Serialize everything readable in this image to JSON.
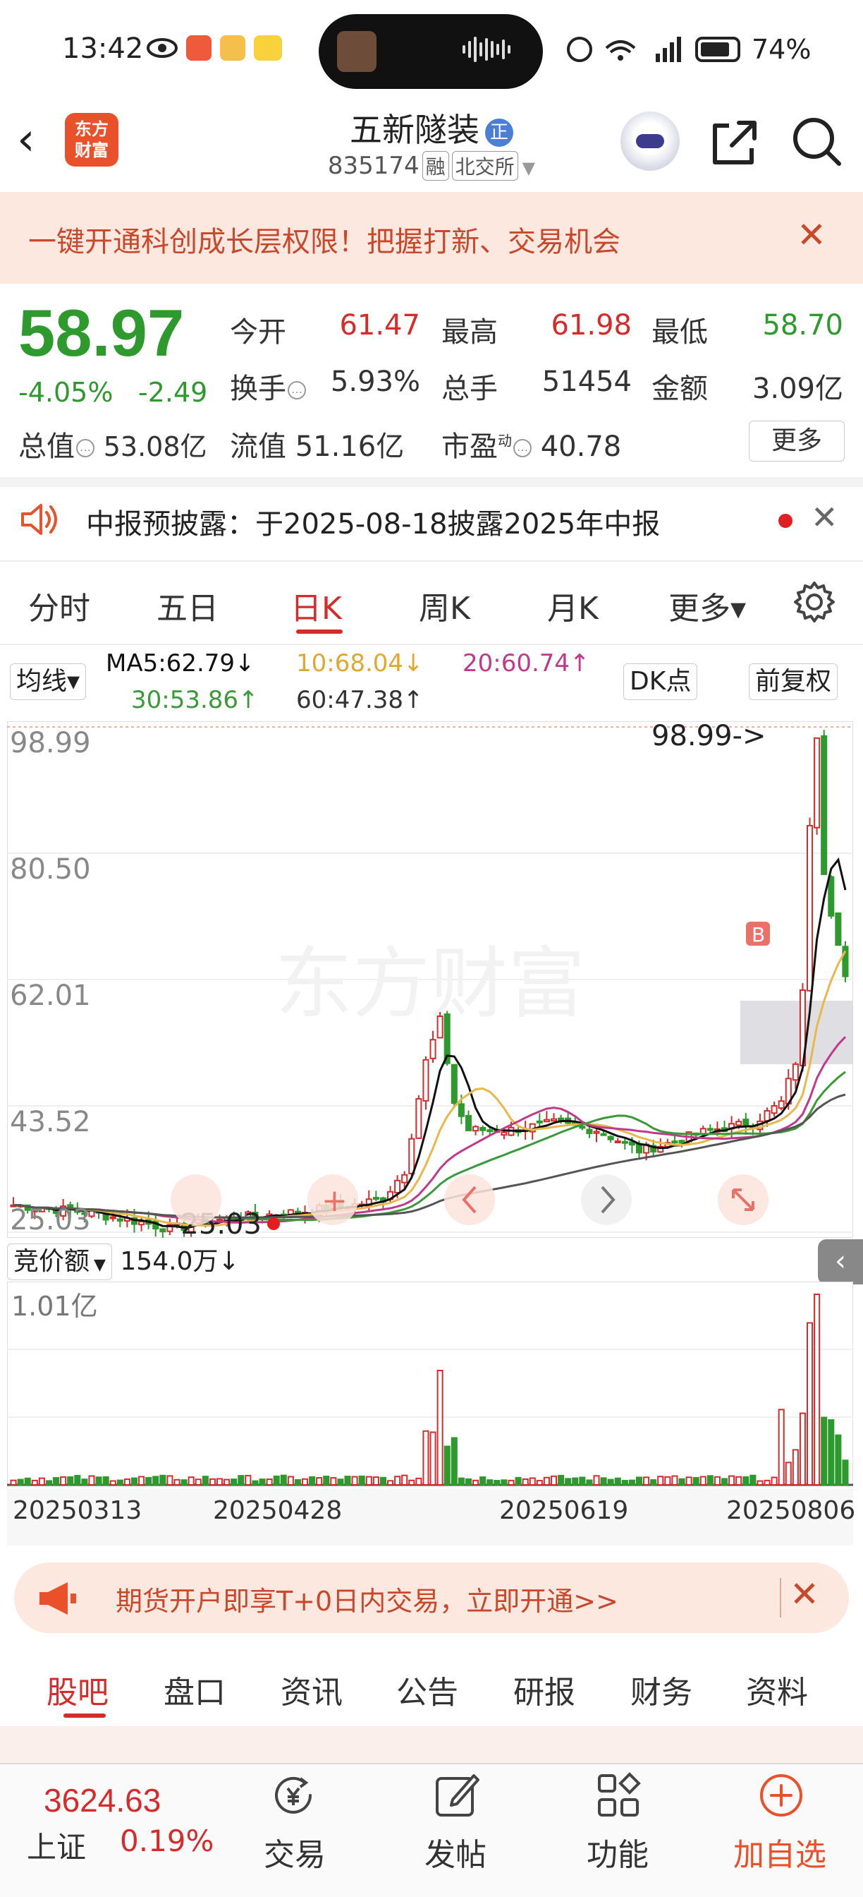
{
  "status": {
    "time": "13:42",
    "battery": "74%"
  },
  "header": {
    "logo_line1": "东方",
    "logo_line2": "财富",
    "name": "五新隧装",
    "name_badge": "正",
    "code": "835174",
    "tag1": "融",
    "tag2": "北交所"
  },
  "banner": {
    "text": "一键开通科创成长层权限！把握打新、交易机会",
    "close": "✕"
  },
  "quote": {
    "price": "58.97",
    "change_pct": "-4.05%",
    "change_abs": "-2.49",
    "rows": [
      {
        "l1": "今开",
        "v1": "61.47",
        "c1": "#d62b2b",
        "l2": "最高",
        "v2": "61.98",
        "c2": "#d62b2b",
        "l3": "最低",
        "v3": "58.70",
        "c3": "#2e9a2e"
      },
      {
        "l1": "换手",
        "v1": "5.93%",
        "c1": "#333333",
        "l2": "总手",
        "v2": "51454",
        "c2": "#333333",
        "l3": "金额",
        "v3": "3.09亿",
        "c3": "#333333"
      }
    ],
    "total_cap_label": "总值",
    "total_cap": "53.08亿",
    "float_cap_label": "流值",
    "float_cap": "51.16亿",
    "pe_label": "市盈",
    "pe_sup": "动",
    "pe": "40.78",
    "more": "更多",
    "info_glyph": "…"
  },
  "notice": {
    "text": "中报预披露：于2025-08-18披露2025年中报",
    "close": "✕"
  },
  "ktabs": [
    "分时",
    "五日",
    "日K",
    "周K",
    "月K",
    "更多▾"
  ],
  "ma_row": {
    "selector": "均线▾",
    "ma5": "MA5:62.79↓",
    "ma10": "10:68.04↓",
    "ma20": "20:60.74↑",
    "ma30": "30:53.86↑",
    "ma60": "60:47.38↑",
    "dk": "DK点",
    "adjust": "前复权"
  },
  "chart_data": {
    "type": "candlestick",
    "y_labels": [
      "98.99",
      "80.50",
      "62.01",
      "43.52",
      "25.03"
    ],
    "ylim": [
      25.03,
      98.99
    ],
    "max_label": "98.99->",
    "min_label": "-25.03",
    "b_marker": "B",
    "watermark": "东方财富",
    "colors": {
      "up": "#d62b2b",
      "down": "#2e9a2e",
      "ma5": "#111111",
      "ma10": "#e8b84a",
      "ma20": "#c0398a",
      "ma30": "#3a9a3a",
      "ma60": "#555555"
    },
    "volume": {
      "header": "竞价额",
      "header_value": "154.0万↓",
      "max_label": "1.01亿"
    },
    "x_labels": [
      "20250313",
      "20250428",
      "20250619",
      "20250806"
    ]
  },
  "futures_banner": {
    "text": "期货开户即享T+0日内交易，立即开通>>",
    "close": "✕"
  },
  "bottom_tabs": [
    "股吧",
    "盘口",
    "资讯",
    "公告",
    "研报",
    "财务",
    "资料"
  ],
  "bottom_nav": {
    "index_value": "3624.63",
    "index_name": "上证",
    "index_change": "0.19%",
    "trade": "交易",
    "post": "发帖",
    "functions": "功能",
    "add": "加自选"
  }
}
